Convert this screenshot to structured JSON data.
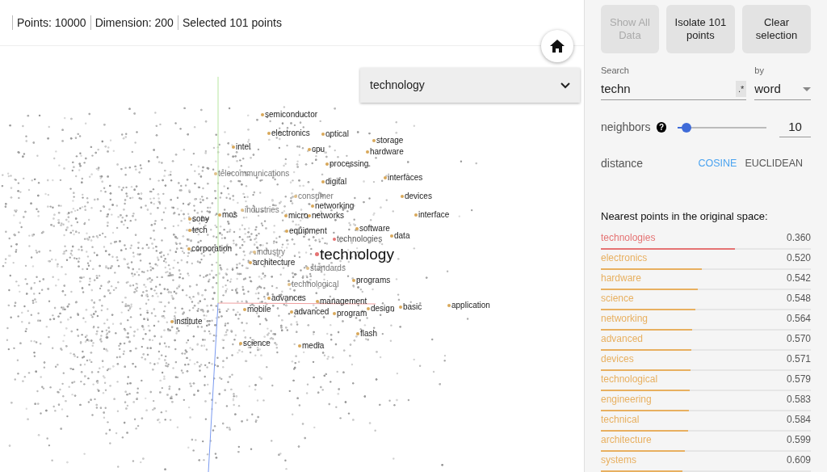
{
  "status": [
    "Points: 10000",
    "Dimension: 200",
    "Selected 101 points"
  ],
  "selection_dropdown": {
    "value": "technology"
  },
  "plot_labels": [
    {
      "text": "semiconductor",
      "kind": "neighbor"
    },
    {
      "text": "electronics",
      "kind": "neighbor"
    },
    {
      "text": "optical",
      "kind": "neighbor"
    },
    {
      "text": "storage",
      "kind": "neighbor"
    },
    {
      "text": "intel",
      "kind": "neighbor"
    },
    {
      "text": "cpu",
      "kind": "neighbor"
    },
    {
      "text": "hardware",
      "kind": "neighbor"
    },
    {
      "text": "processing",
      "kind": "neighbor"
    },
    {
      "text": "telecommunications",
      "kind": "faded"
    },
    {
      "text": "digital",
      "kind": "neighbor"
    },
    {
      "text": "interfaces",
      "kind": "neighbor"
    },
    {
      "text": "devices",
      "kind": "neighbor"
    },
    {
      "text": "consumer",
      "kind": "faded"
    },
    {
      "text": "networking",
      "kind": "neighbor"
    },
    {
      "text": "industries",
      "kind": "faded"
    },
    {
      "text": "mos",
      "kind": "neighbor"
    },
    {
      "text": "micro",
      "kind": "neighbor"
    },
    {
      "text": "networks",
      "kind": "neighbor"
    },
    {
      "text": "interface",
      "kind": "neighbor"
    },
    {
      "text": "sony",
      "kind": "neighbor"
    },
    {
      "text": "tech",
      "kind": "neighbor"
    },
    {
      "text": "equipment",
      "kind": "neighbor"
    },
    {
      "text": "software",
      "kind": "neighbor"
    },
    {
      "text": "technologies",
      "kind": "nearest"
    },
    {
      "text": "data",
      "kind": "neighbor"
    },
    {
      "text": "corporation",
      "kind": "neighbor"
    },
    {
      "text": "industry",
      "kind": "faded"
    },
    {
      "text": "architecture",
      "kind": "neighbor"
    },
    {
      "text": "technology",
      "kind": "query"
    },
    {
      "text": "standards",
      "kind": "faded"
    },
    {
      "text": "technological",
      "kind": "faded"
    },
    {
      "text": "programs",
      "kind": "neighbor"
    },
    {
      "text": "advances",
      "kind": "neighbor"
    },
    {
      "text": "management",
      "kind": "neighbor"
    },
    {
      "text": "mobile",
      "kind": "neighbor"
    },
    {
      "text": "advanced",
      "kind": "neighbor"
    },
    {
      "text": "program",
      "kind": "neighbor"
    },
    {
      "text": "design",
      "kind": "neighbor"
    },
    {
      "text": "basic",
      "kind": "neighbor"
    },
    {
      "text": "application",
      "kind": "neighbor"
    },
    {
      "text": "institute",
      "kind": "neighbor"
    },
    {
      "text": "flash",
      "kind": "neighbor"
    },
    {
      "text": "science",
      "kind": "neighbor"
    },
    {
      "text": "media",
      "kind": "neighbor"
    }
  ],
  "buttons": [
    {
      "label": "Show All Data",
      "disabled": true
    },
    {
      "label": "Isolate 101 points",
      "disabled": false
    },
    {
      "label": "Clear selection",
      "disabled": false
    }
  ],
  "search": {
    "label": "Search",
    "value": "techn",
    "regex_toggle": ".*",
    "by_label": "by",
    "by_value": "word"
  },
  "neighbors": {
    "label": "neighbors",
    "help": "?",
    "level": 0.05,
    "value": "10"
  },
  "distance": {
    "label": "distance",
    "options": [
      {
        "label": "COSINE",
        "selected": true
      },
      {
        "label": "EUCLIDEAN",
        "selected": false
      }
    ]
  },
  "nearest": {
    "title": "Nearest points in the original space:",
    "items": [
      {
        "word": "technologies",
        "value": "0.360",
        "level": 0.64,
        "color": "#e57373"
      },
      {
        "word": "electronics",
        "value": "0.520",
        "level": 0.48,
        "color": "#e8b060"
      },
      {
        "word": "hardware",
        "value": "0.542",
        "level": 0.46,
        "color": "#e8b060"
      },
      {
        "word": "science",
        "value": "0.548",
        "level": 0.45,
        "color": "#e8b060"
      },
      {
        "word": "networking",
        "value": "0.564",
        "level": 0.435,
        "color": "#e8b060"
      },
      {
        "word": "advanced",
        "value": "0.570",
        "level": 0.43,
        "color": "#e8b060"
      },
      {
        "word": "devices",
        "value": "0.571",
        "level": 0.428,
        "color": "#e8b060"
      },
      {
        "word": "technological",
        "value": "0.579",
        "level": 0.422,
        "color": "#e8b060"
      },
      {
        "word": "engineering",
        "value": "0.583",
        "level": 0.418,
        "color": "#e8b060"
      },
      {
        "word": "technical",
        "value": "0.584",
        "level": 0.415,
        "color": "#e8b060"
      },
      {
        "word": "architecture",
        "value": "0.599",
        "level": 0.4,
        "color": "#e8b060"
      },
      {
        "word": "systems",
        "value": "0.609",
        "level": 0.39,
        "color": "#e8b060"
      }
    ]
  }
}
